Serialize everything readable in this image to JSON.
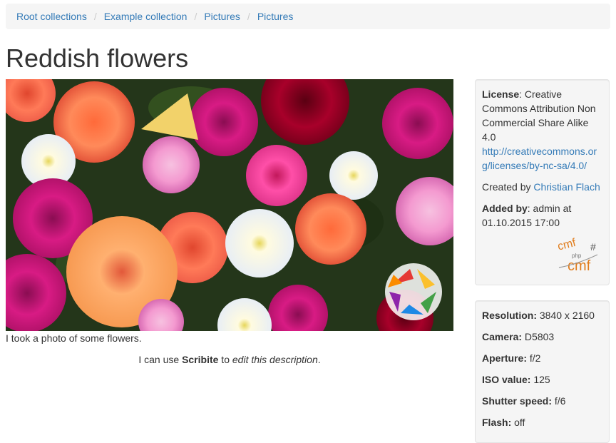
{
  "breadcrumb": [
    "Root collections",
    "Example collection",
    "Pictures",
    "Pictures"
  ],
  "title": "Reddish flowers",
  "image": {
    "alt": "Reddish flowers"
  },
  "caption": "I took a photo of some flowers.",
  "description": {
    "pre": "I can use ",
    "bold": "Scribite",
    "mid": " to ",
    "italic": "edit this description",
    "post": "."
  },
  "meta": {
    "license_label": "License",
    "license_text": ": Creative Commons Attribution Non Commercial Share Alike 4.0",
    "license_url": "http://creativecommons.org/licenses/by-nc-sa/4.0/",
    "created_by_label": "Created by ",
    "created_by": "Christian Flach",
    "added_by_label": "Added by",
    "added_by_text": ": admin at 01.10.2015 17:00",
    "logo_text_top": "cmf",
    "logo_text_mid": "php",
    "logo_text_hash": "#",
    "logo_text_bottom": "cmf"
  },
  "exif": [
    {
      "label": "Resolution:",
      "value": " 3840 x 2160"
    },
    {
      "label": "Camera:",
      "value": " D5803"
    },
    {
      "label": "Aperture:",
      "value": " f/2"
    },
    {
      "label": "ISO value:",
      "value": " 125"
    },
    {
      "label": "Shutter speed:",
      "value": " f/6"
    },
    {
      "label": "Flash:",
      "value": " off"
    }
  ],
  "colors": {
    "link": "#337ab7",
    "panel_bg": "#f5f5f5",
    "text": "#333333"
  }
}
